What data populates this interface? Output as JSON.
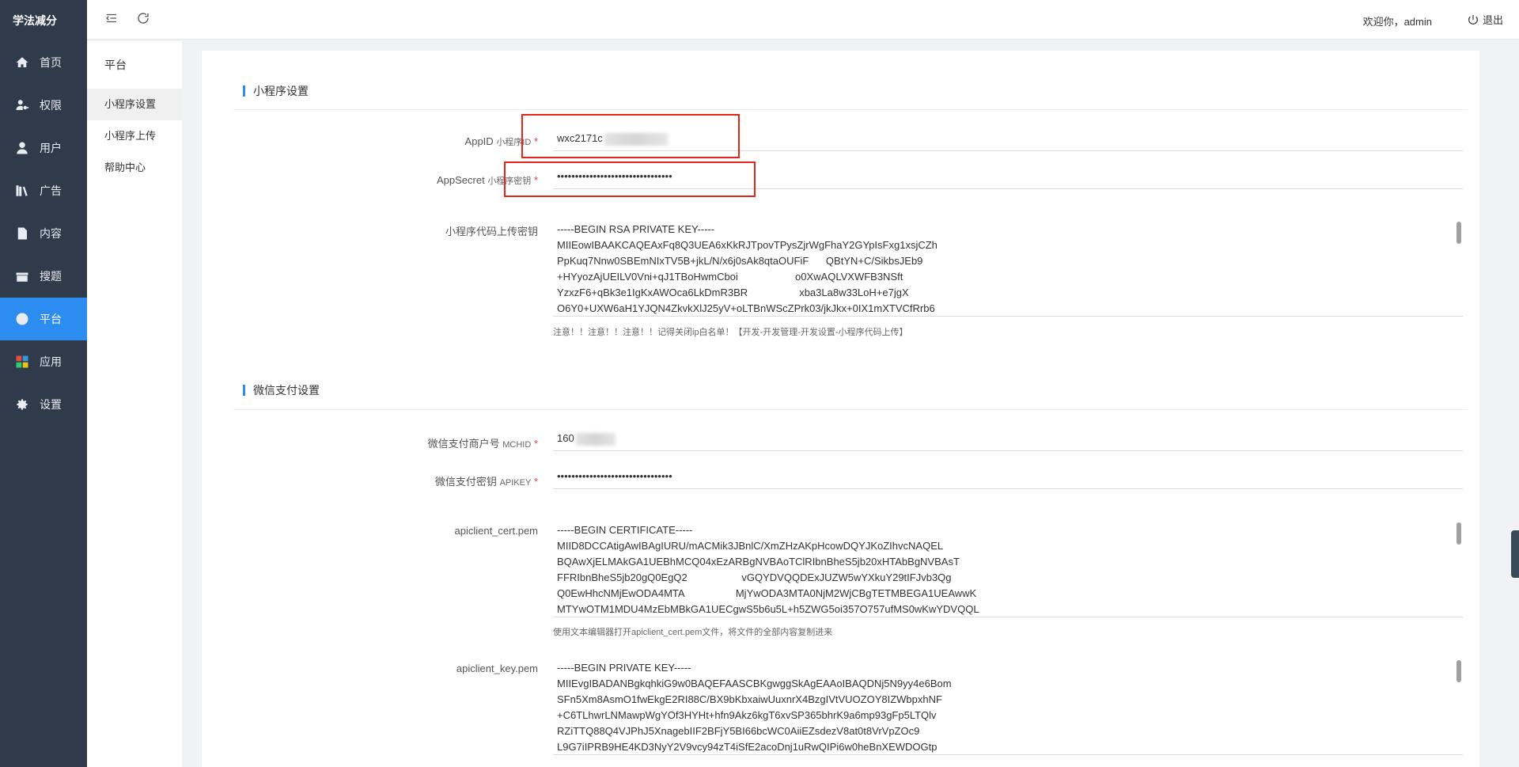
{
  "sidebar": {
    "brand": "学法减分",
    "items": [
      {
        "label": "首页",
        "icon": "home-icon"
      },
      {
        "label": "权限",
        "icon": "user-key-icon"
      },
      {
        "label": "用户",
        "icon": "user-icon"
      },
      {
        "label": "广告",
        "icon": "books-icon"
      },
      {
        "label": "内容",
        "icon": "document-icon"
      },
      {
        "label": "搜题",
        "icon": "inbox-icon"
      },
      {
        "label": "平台",
        "icon": "platform-icon",
        "active": true
      },
      {
        "label": "应用",
        "icon": "apps-icon"
      },
      {
        "label": "设置",
        "icon": "gear-icon"
      }
    ]
  },
  "submenu": {
    "title": "平台",
    "items": [
      {
        "label": "小程序设置",
        "active": true
      },
      {
        "label": "小程序上传"
      },
      {
        "label": "帮助中心"
      }
    ]
  },
  "header": {
    "welcome": "欢迎你，admin",
    "logout": "退出"
  },
  "miniprogram": {
    "title": "小程序设置",
    "appid": {
      "label": "AppID",
      "sub": "小程序ID",
      "value": "wxc2171c"
    },
    "appsecret": {
      "label": "AppSecret",
      "sub": "小程序密钥",
      "value": "••••••••••••••••••••••••••••••••"
    },
    "upload_key": {
      "label": "小程序代码上传密钥",
      "value": "-----BEGIN RSA PRIVATE KEY-----\nMIIEowIBAAKCAQEAxFq8Q3UEA6xKkRJTpovTPysZjrWgFhaY2GYpIsFxg1xsjCZh\nPpKuq7Nnw0SBEmNIxTV5B+jkL/N/x6j0sAk8qtaOUFiF      QBtYN+C/SikbsJEb9\n+HYyozAjUEILV0Vni+qJ1TBoHwmCboi                    o0XwAQLVXWFB3NSft\nYzxzF6+qBk3e1IgKxAWOca6LkDmR3BR                  xba3La8w33LoH+e7jgX\nO6Y0+UXW6aH1YJQN4ZkvkXlJ25yV+oLTBnWScZPrk03/jkJkx+0IX1mXTVCfRrb6",
      "hint": "注意！！注意！！注意！！记得关闭ip白名单！【开发-开发管理-开发设置-小程序代码上传】"
    }
  },
  "wxpay": {
    "title": "微信支付设置",
    "mchid": {
      "label": "微信支付商户号",
      "sub": "MCHID",
      "value": "160"
    },
    "apikey": {
      "label": "微信支付密钥",
      "sub": "APIKEY",
      "value": "••••••••••••••••••••••••••••••••"
    },
    "cert": {
      "label": "apiclient_cert.pem",
      "value": "-----BEGIN CERTIFICATE-----\nMIID8DCCAtigAwIBAgIURU/mACMik3JBnlC/XmZHzAKpHcowDQYJKoZIhvcNAQEL\nBQAwXjELMAkGA1UEBhMCQ04xEzARBgNVBAoTClRIbnBheS5jb20xHTAbBgNVBAsT\nFFRIbnBheS5jb20gQ0EgQ2                   vGQYDVQQDExJUZW5wYXkuY29tIFJvb3Qg\nQ0EwHhcNMjEwODA4MTA                  MjYwODA3MTA0NjM2WjCBgTETMBEGA1UEAwwK\nMTYwOTM1MDU4MzEbMBkGA1UECgwS5b6u5L+h5ZWG5oi357O757ufMS0wKwYDVQQL",
      "hint": "使用文本编辑器打开apiclient_cert.pem文件，将文件的全部内容复制进来"
    },
    "key": {
      "label": "apiclient_key.pem",
      "value": "-----BEGIN PRIVATE KEY-----\nMIIEvgIBADANBgkqhkiG9w0BAQEFAASCBKgwggSkAgEAAoIBAQDNj5N9yy4e6Bom\nSFn5Xm8AsmO1fwEkgE2RI88C/BX9bKbxaiwUuxnrX4BzgIVtVUOZOY8IZWbpxhNF\n+C6TLhwrLNMawpWgYOf3HYHt+hfn9Akz6kgT6xvSP365bhrK9a6mp93gFp5LTQlv\nRZiTTQ88Q4VJPhJ5XnagebIIF2BFjY5BI66bcWC0AiiEZsdezV8at0t8VrVpZOc9\nL9G7iIPRB9HE4KD3NyY2V9vcy94zT4iSfE2acoDnj1uRwQIPi6w0heBnXEWDOGtp"
    }
  },
  "colors": {
    "sidebar_bg": "#2f3a4a",
    "accent": "#2d8cf0",
    "highlight_box": "#e4251a"
  }
}
